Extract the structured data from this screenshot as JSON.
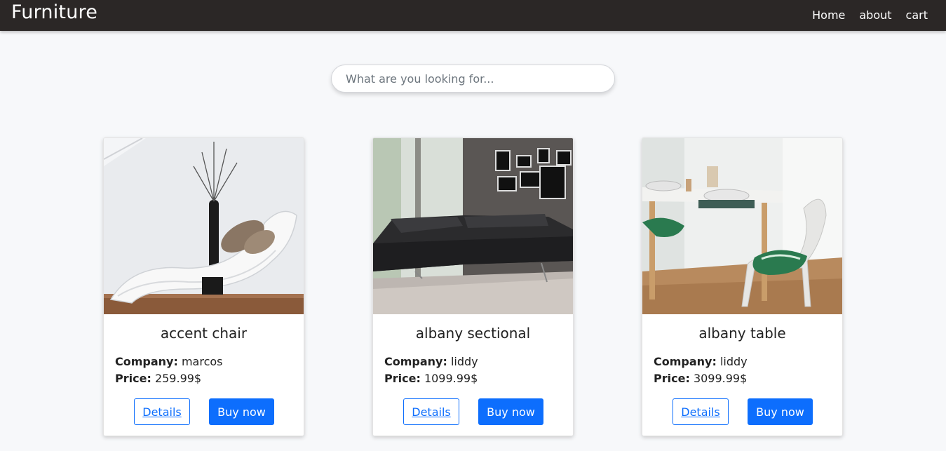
{
  "navbar": {
    "brand": "Furniture",
    "links": [
      "Home",
      "about",
      "cart"
    ]
  },
  "search": {
    "placeholder": "What are you looking for..."
  },
  "products": [
    {
      "title": "accent chair",
      "company_label": "Company:",
      "company": "marcos",
      "price_label": "Price:",
      "price": "259.99$",
      "details_label": "Details",
      "buy_label": "Buy now"
    },
    {
      "title": "albany sectional",
      "company_label": "Company:",
      "company": "liddy",
      "price_label": "Price:",
      "price": "1099.99$",
      "details_label": "Details",
      "buy_label": "Buy now"
    },
    {
      "title": "albany table",
      "company_label": "Company:",
      "company": "liddy",
      "price_label": "Price:",
      "price": "3099.99$",
      "details_label": "Details",
      "buy_label": "Buy now"
    }
  ],
  "colors": {
    "navbar_bg": "#2b2726",
    "page_bg": "#f7f8fa",
    "primary": "#0d6efd"
  }
}
